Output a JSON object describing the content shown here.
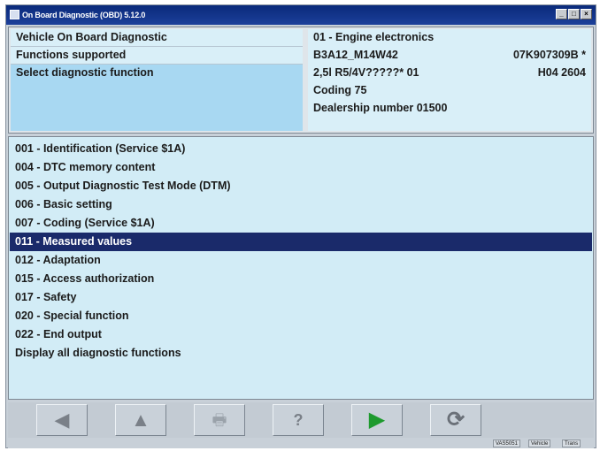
{
  "window": {
    "title": "On Board Diagnostic (OBD) 5.12.0",
    "controls": [
      "_",
      "□",
      "×"
    ]
  },
  "header": {
    "left_rows": [
      "Vehicle On Board Diagnostic",
      "Functions supported",
      "Select diagnostic function"
    ],
    "right": {
      "module": "01 - Engine electronics",
      "sw_number": "B3A12_M14W42",
      "part_number": "07K907309B  *",
      "engine": "2,5l R5/4V?????* 01",
      "version": "H04  2604",
      "coding": "Coding 75",
      "dealership": "Dealership number 01500"
    }
  },
  "functions": [
    "001 - Identification (Service $1A)",
    "004 - DTC memory content",
    "005 - Output Diagnostic Test Mode (DTM)",
    "006 - Basic setting",
    "007 - Coding (Service $1A)",
    "011 - Measured values",
    "012 - Adaptation",
    "015 - Access authorization",
    "017 - Safety",
    "020 - Special function",
    "022 - End output",
    "Display all diagnostic functions"
  ],
  "selected_index": 5,
  "toolbar": {
    "buttons": [
      {
        "name": "back-icon",
        "glyph": "◀",
        "color": "#7a8088"
      },
      {
        "name": "up-icon",
        "glyph": "▲",
        "color": "#7a8088"
      },
      {
        "name": "print-icon",
        "glyph": "🖶",
        "color": "#9aa2aa"
      },
      {
        "name": "help-icon",
        "glyph": "?",
        "color": "#7a8088"
      },
      {
        "name": "play-icon",
        "glyph": "▶",
        "color": "#1e9a2e"
      },
      {
        "name": "refresh-icon",
        "glyph": "⟳",
        "color": "#6a7078"
      }
    ]
  },
  "status": {
    "cells": [
      "VAS5051",
      "Vehicle",
      "Trans"
    ]
  }
}
